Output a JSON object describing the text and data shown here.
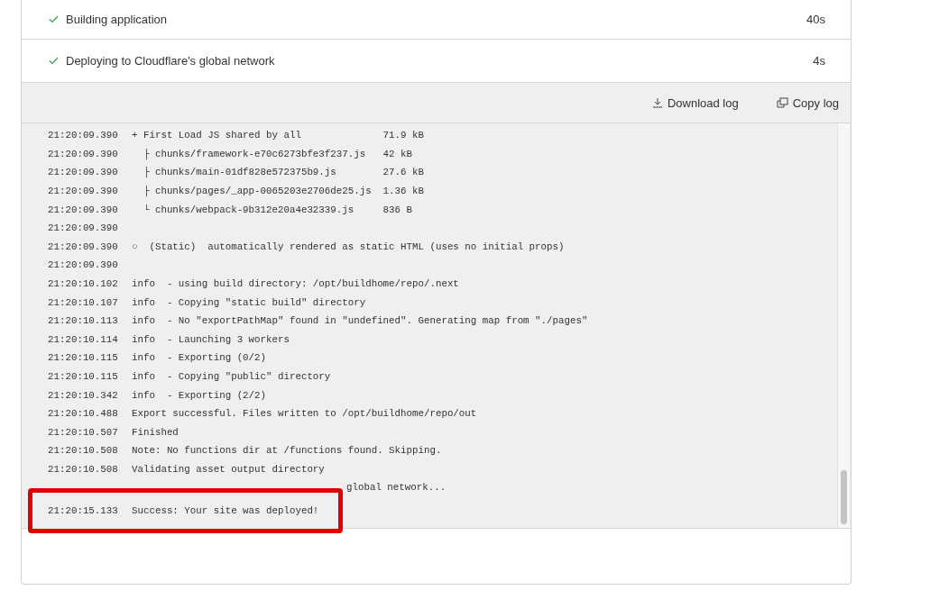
{
  "steps": [
    {
      "label": "Building application",
      "duration": "40s",
      "done": true
    },
    {
      "label": "Deploying to Cloudflare's global network",
      "duration": "4s",
      "done": true
    }
  ],
  "toolbar": {
    "download": "Download log",
    "copy": "Copy log"
  },
  "log": [
    {
      "time": "21:20:09.390",
      "message": "+ First Load JS shared by all              71.9 kB"
    },
    {
      "time": "21:20:09.390",
      "message": "  ├ chunks/framework-e70c6273bfe3f237.js   42 kB"
    },
    {
      "time": "21:20:09.390",
      "message": "  ├ chunks/main-01df828e572375b9.js        27.6 kB"
    },
    {
      "time": "21:20:09.390",
      "message": "  ├ chunks/pages/_app-0065203e2706de25.js  1.36 kB"
    },
    {
      "time": "21:20:09.390",
      "message": "  └ chunks/webpack-9b312e20a4e32339.js     836 B"
    },
    {
      "time": "21:20:09.390"
    },
    {
      "time": "21:20:09.390",
      "message": "○  (Static)  automatically rendered as static HTML (uses no initial props)"
    },
    {
      "time": "21:20:09.390"
    },
    {
      "time": "21:20:10.102",
      "message": "info  - using build directory: /opt/buildhome/repo/.next"
    },
    {
      "time": "21:20:10.107",
      "message": "info  - Copying \"static build\" directory"
    },
    {
      "time": "21:20:10.113",
      "message": "info  - No \"exportPathMap\" found in \"undefined\". Generating map from \"./pages\""
    },
    {
      "time": "21:20:10.114",
      "message": "info  - Launching 3 workers"
    },
    {
      "time": "21:20:10.115",
      "message": "info  - Exporting (0/2)"
    },
    {
      "time": "21:20:10.115",
      "message": "info  - Copying \"public\" directory"
    },
    {
      "time": "21:20:10.342",
      "message": "info  - Exporting (2/2)"
    },
    {
      "time": "21:20:10.488",
      "message": "Export successful. Files written to /opt/buildhome/repo/out"
    },
    {
      "time": "21:20:10.507",
      "message": "Finished"
    },
    {
      "time": "21:20:10.508",
      "message": "Note: No functions dir at /functions found. Skipping."
    },
    {
      "time": "21:20:10.508",
      "message": "Validating asset output directory"
    }
  ],
  "covered_line": {
    "visible_text": "global network..."
  },
  "highlighted_line": {
    "time": "21:20:15.133",
    "message": "Success: Your site was deployed!"
  }
}
